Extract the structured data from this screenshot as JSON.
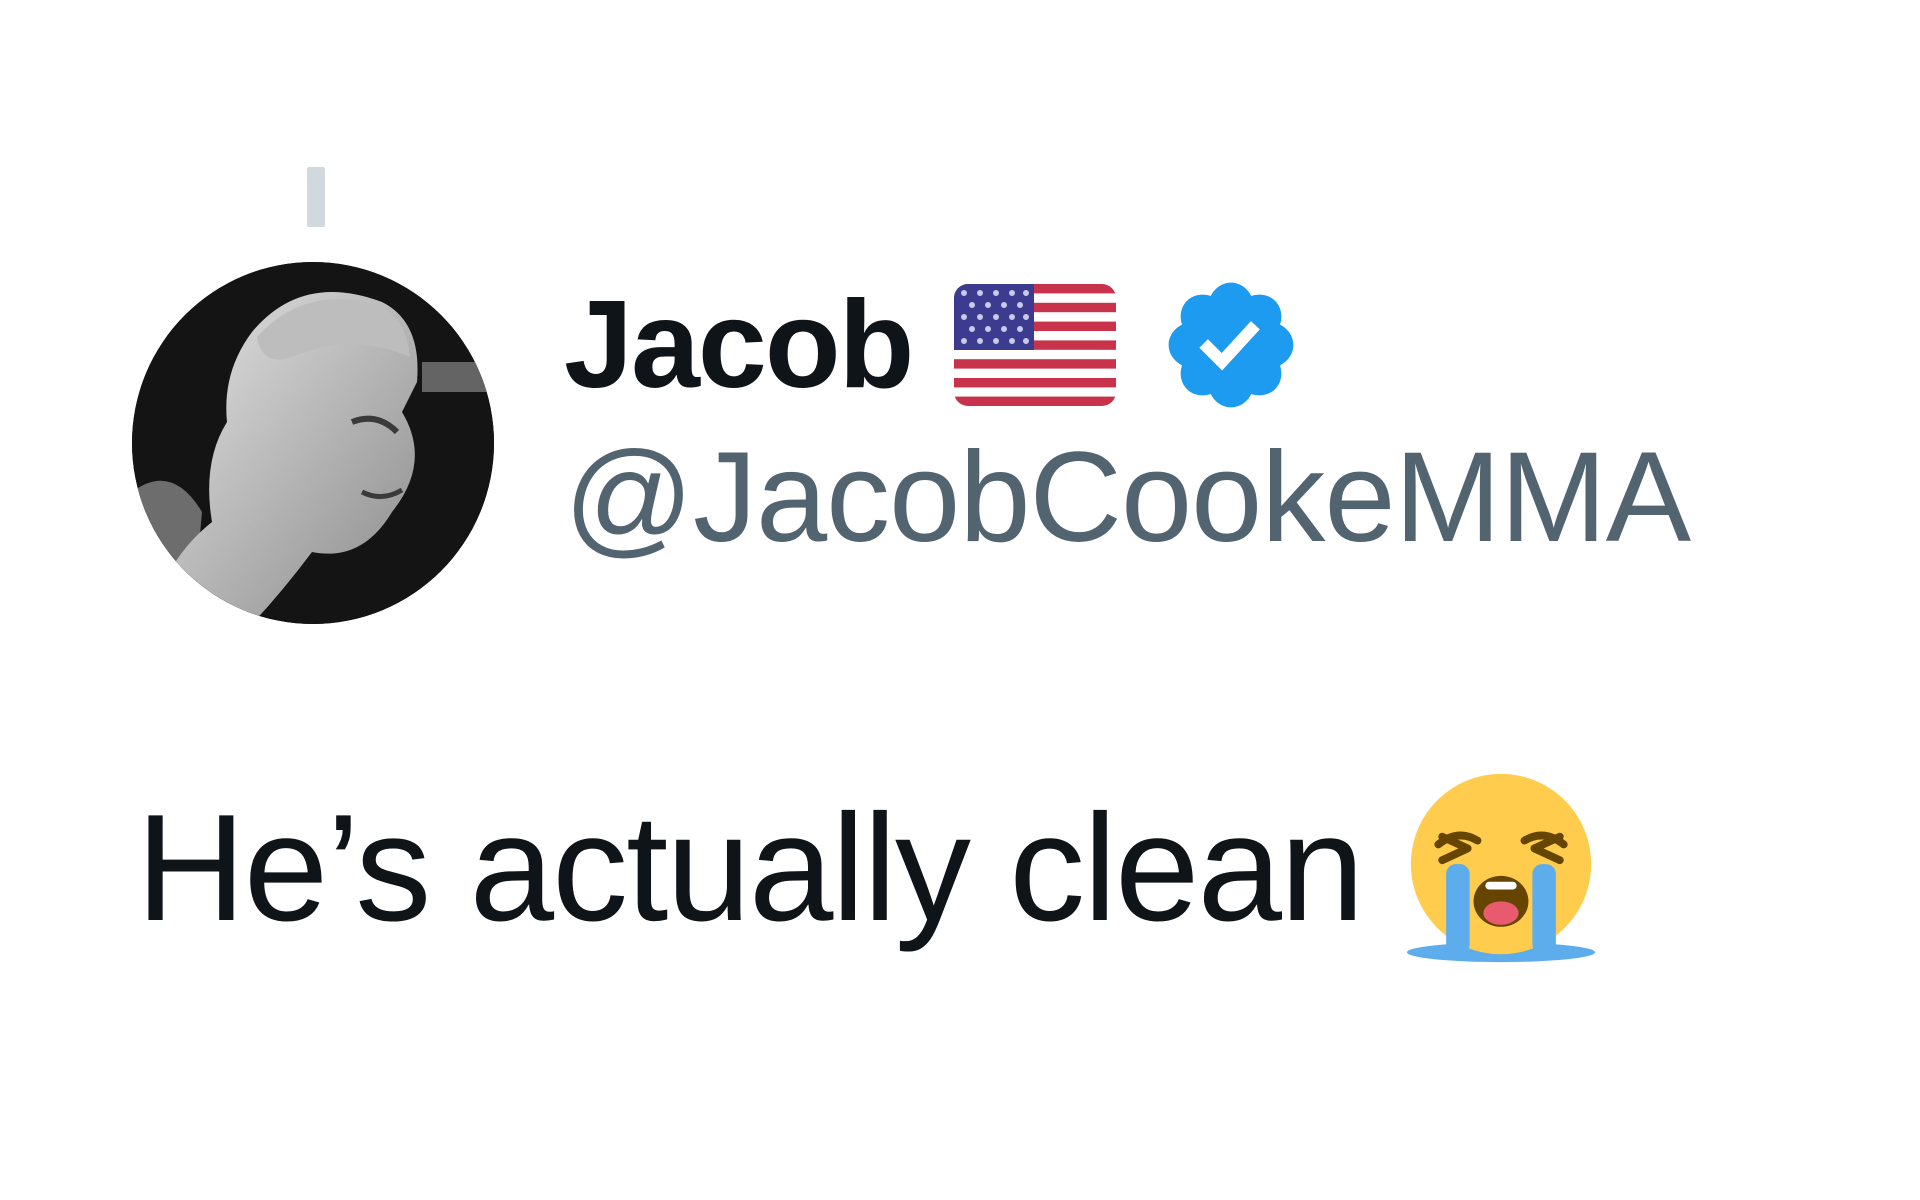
{
  "tweet": {
    "author": {
      "display_name": "Jacob",
      "handle": "@JacobCookeMMA",
      "flag_icon": "us-flag-icon",
      "verified_icon": "verified-badge-icon",
      "verified_color": "#1d9bf0"
    },
    "body": {
      "text": "He’s actually clean",
      "emoji_icon": "loudly-crying-face-icon"
    }
  },
  "colors": {
    "name": "#0f1419",
    "handle": "#536471",
    "text": "#0f1419",
    "thread_line": "#cfd9de",
    "background": "#ffffff"
  }
}
